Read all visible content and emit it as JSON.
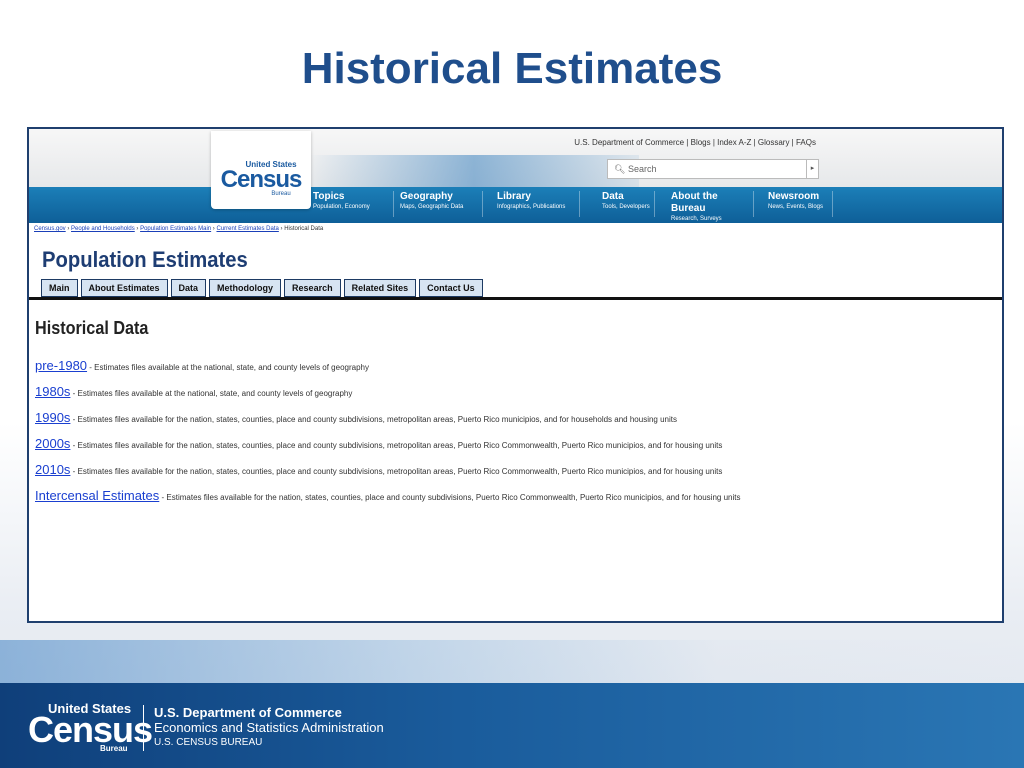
{
  "slide": {
    "title": "Historical Estimates"
  },
  "header": {
    "util_links": "U.S. Department of Commerce | Blogs | Index A-Z | Glossary | FAQs",
    "search_placeholder": "Search",
    "logo": {
      "us": "United States",
      "census": "Census",
      "bureau": "Bureau"
    },
    "nav": [
      {
        "title": "Topics",
        "sub": "Population, Economy"
      },
      {
        "title": "Geography",
        "sub": "Maps, Geographic Data"
      },
      {
        "title": "Library",
        "sub": "Infographics, Publications"
      },
      {
        "title": "Data",
        "sub": "Tools, Developers"
      },
      {
        "title": "About the Bureau",
        "sub": "Research, Surveys"
      },
      {
        "title": "Newsroom",
        "sub": "News, Events, Blogs"
      }
    ]
  },
  "breadcrumb": {
    "items": [
      "Census.gov",
      "People and Households",
      "Population Estimates Main",
      "Current Estimates Data"
    ],
    "current": "Historical Data"
  },
  "page": {
    "title": "Population Estimates",
    "tabs": [
      "Main",
      "About Estimates",
      "Data",
      "Methodology",
      "Research",
      "Related Sites",
      "Contact Us"
    ],
    "section_title": "Historical Data",
    "rows": [
      {
        "link": "pre-1980",
        "desc": " - Estimates files available at the national, state, and county levels of geography"
      },
      {
        "link": "1980s",
        "desc": " - Estimates files available at the national, state, and county levels of geography"
      },
      {
        "link": "1990s",
        "desc": " - Estimates files available for the nation, states, counties, place and county subdivisions, metropolitan areas, Puerto Rico municipios, and for households and housing units"
      },
      {
        "link": "2000s",
        "desc": " - Estimates files available for the nation, states, counties, place and county subdivisions, metropolitan areas, Puerto Rico Commonwealth, Puerto Rico municipios, and for housing units"
      },
      {
        "link": "2010s",
        "desc": " - Estimates files available for the nation, states, counties, place and county subdivisions, metropolitan areas, Puerto Rico Commonwealth, Puerto Rico municipios, and for housing units"
      },
      {
        "link": "Intercensal Estimates",
        "desc": " - Estimates files available for the nation, states, counties, place and county subdivisions, Puerto Rico Commonwealth, Puerto Rico municipios, and for housing units"
      }
    ]
  },
  "footer": {
    "logo": {
      "us": "United States",
      "census": "Census",
      "bureau": "Bureau"
    },
    "line1": "U.S. Department of Commerce",
    "line2": "Economics and Statistics Administration",
    "line3": "U.S. CENSUS BUREAU"
  }
}
